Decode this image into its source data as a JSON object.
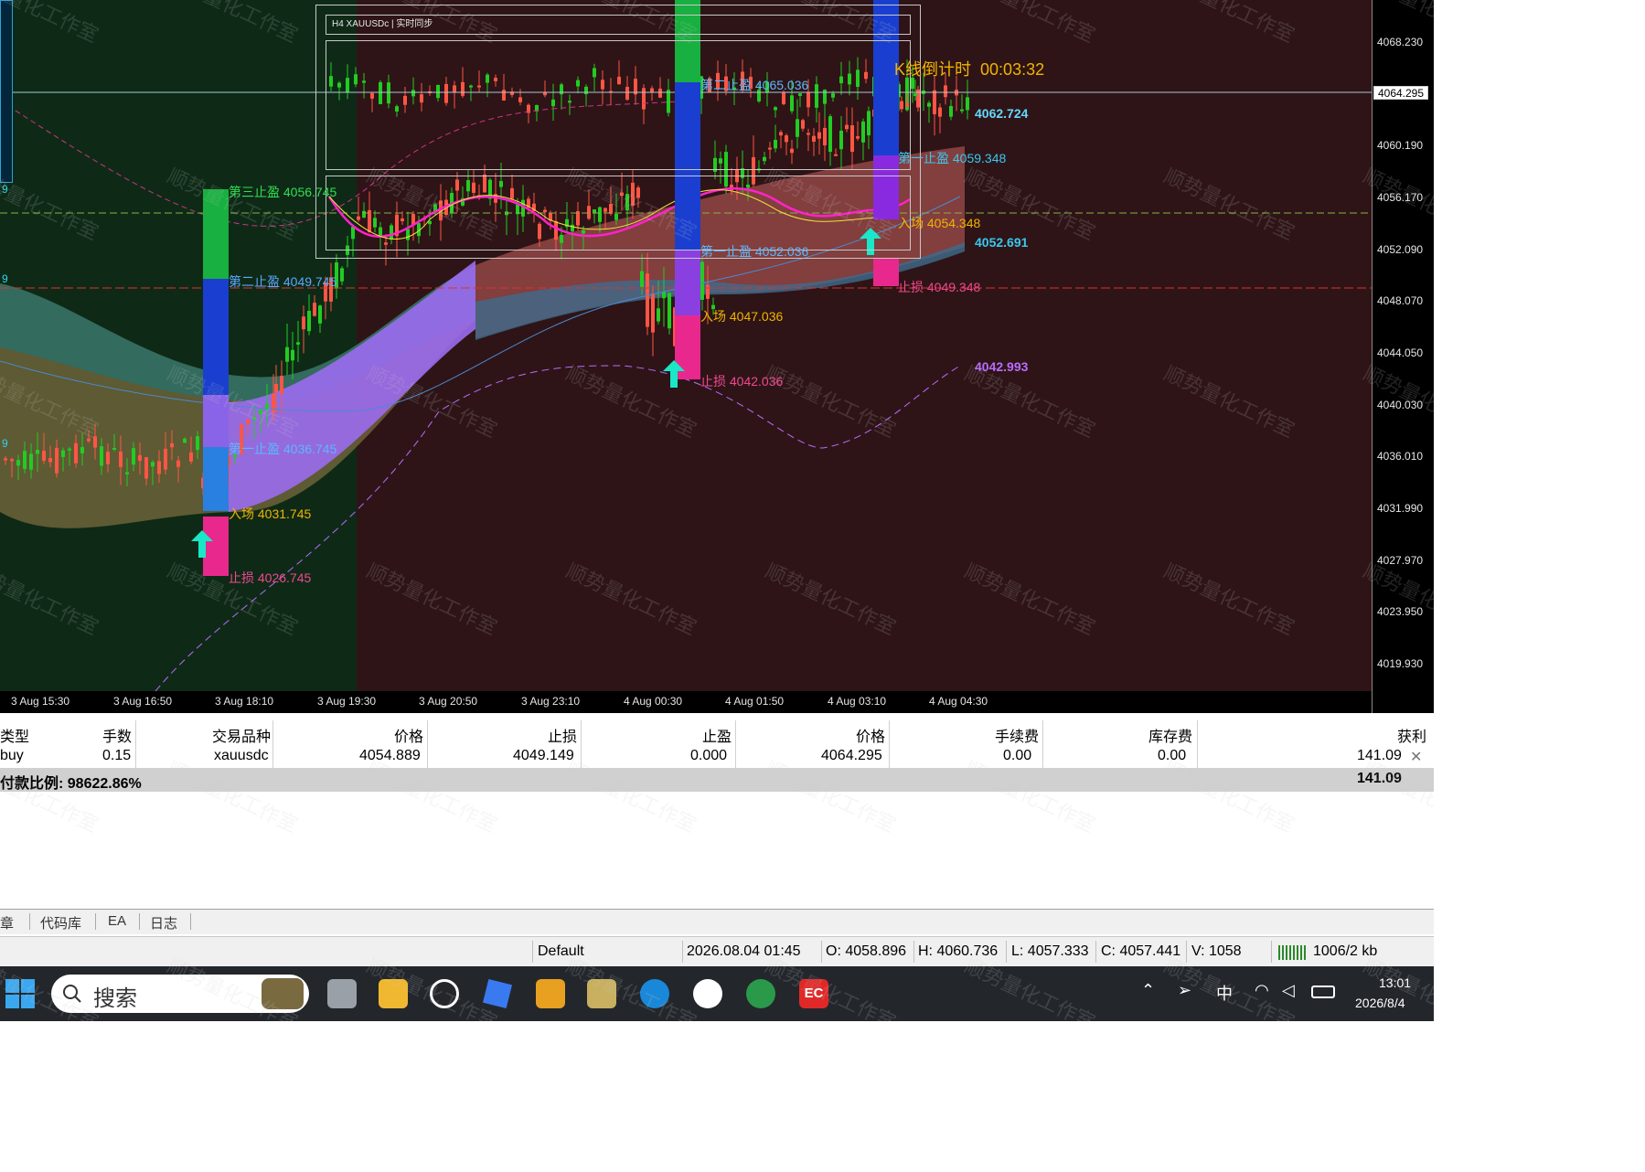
{
  "chart": {
    "symbol_title": "H4  XAUUSDc  |  实时同步",
    "countdown_label": "K线倒计时",
    "countdown_value": "00:03:32",
    "current_price": "4064.295",
    "level_labels": {
      "label_4062": "4062.724",
      "label_4052": "4052.691",
      "label_4042": "4042.993"
    },
    "price_axis": [
      "4068.230",
      "4064.295",
      "4060.190",
      "4056.170",
      "4052.090",
      "4048.070",
      "4044.050",
      "4040.030",
      "4036.010",
      "4031.990",
      "4027.970",
      "4023.950",
      "4019.930"
    ],
    "time_axis": [
      "3 Aug 15:30",
      "3 Aug 16:50",
      "3 Aug 18:10",
      "3 Aug 19:30",
      "3 Aug 20:50",
      "3 Aug 23:10",
      "4 Aug 00:30",
      "4 Aug 01:50",
      "4 Aug 03:10",
      "4 Aug 04:30"
    ],
    "signals": [
      {
        "tp3": "第三止盈  4056.745",
        "tp2": "第二止盈  4049.745",
        "tp1": "第一止盈  4036.745",
        "entry": "入场  4031.745",
        "sl": "止损  4026.745"
      },
      {
        "tp2": "第二止盈  4065.036",
        "tp1": "第一止盈  4052.036",
        "entry": "入场  4047.036",
        "sl": "止损  4042.036"
      },
      {
        "tp1": "第一止盈  4059.348",
        "entry": "入场  4054.348",
        "sl": "止损  4049.348"
      }
    ],
    "left_edge_marks": [
      "9",
      "9",
      "9"
    ],
    "watermark": "顺势量化工作室",
    "colors": {
      "bull": "#22cc22",
      "bear": "#ff5544",
      "tp3": "#18b040",
      "tp2": "#1a3fd0",
      "tp1": "#2a80e0",
      "sl": "#e8288c",
      "arrow": "#18e8c8",
      "left_bg": "#0e2a16",
      "right_bg": "#2e1416"
    }
  },
  "terminal": {
    "headers": [
      "类型",
      "手数",
      "交易品种",
      "价格",
      "止损",
      "止盈",
      "价格",
      "手续费",
      "库存费",
      "获利"
    ],
    "row": [
      "buy",
      "0.15",
      "xauusdc",
      "4054.889",
      "4049.149",
      "0.000",
      "4064.295",
      "0.00",
      "0.00",
      "141.09"
    ],
    "summary_label": "付款比例: 98622.86%",
    "summary_value": "141.09",
    "close_glyph": "✕",
    "tabs": [
      "章",
      "代码库",
      "EA",
      "日志"
    ]
  },
  "status": {
    "profile": "Default",
    "datetime": "2026.08.04 01:45",
    "open": "O: 4058.896",
    "high": "H: 4060.736",
    "low": "L: 4057.333",
    "close": "C: 4057.441",
    "volume": "V: 1058",
    "traffic": "1006/2 kb"
  },
  "taskbar": {
    "search_placeholder": "搜索",
    "ime": "中",
    "time": "13:01",
    "date": "2026/8/4",
    "apps": [
      "windows-start-icon",
      "file-manager-icon",
      "folder-icon",
      "chatgpt-icon",
      "feishu-icon",
      "sublime-icon",
      "notes-icon",
      "edge-icon",
      "qq-icon",
      "mt5-icon",
      "ec-icon"
    ]
  }
}
